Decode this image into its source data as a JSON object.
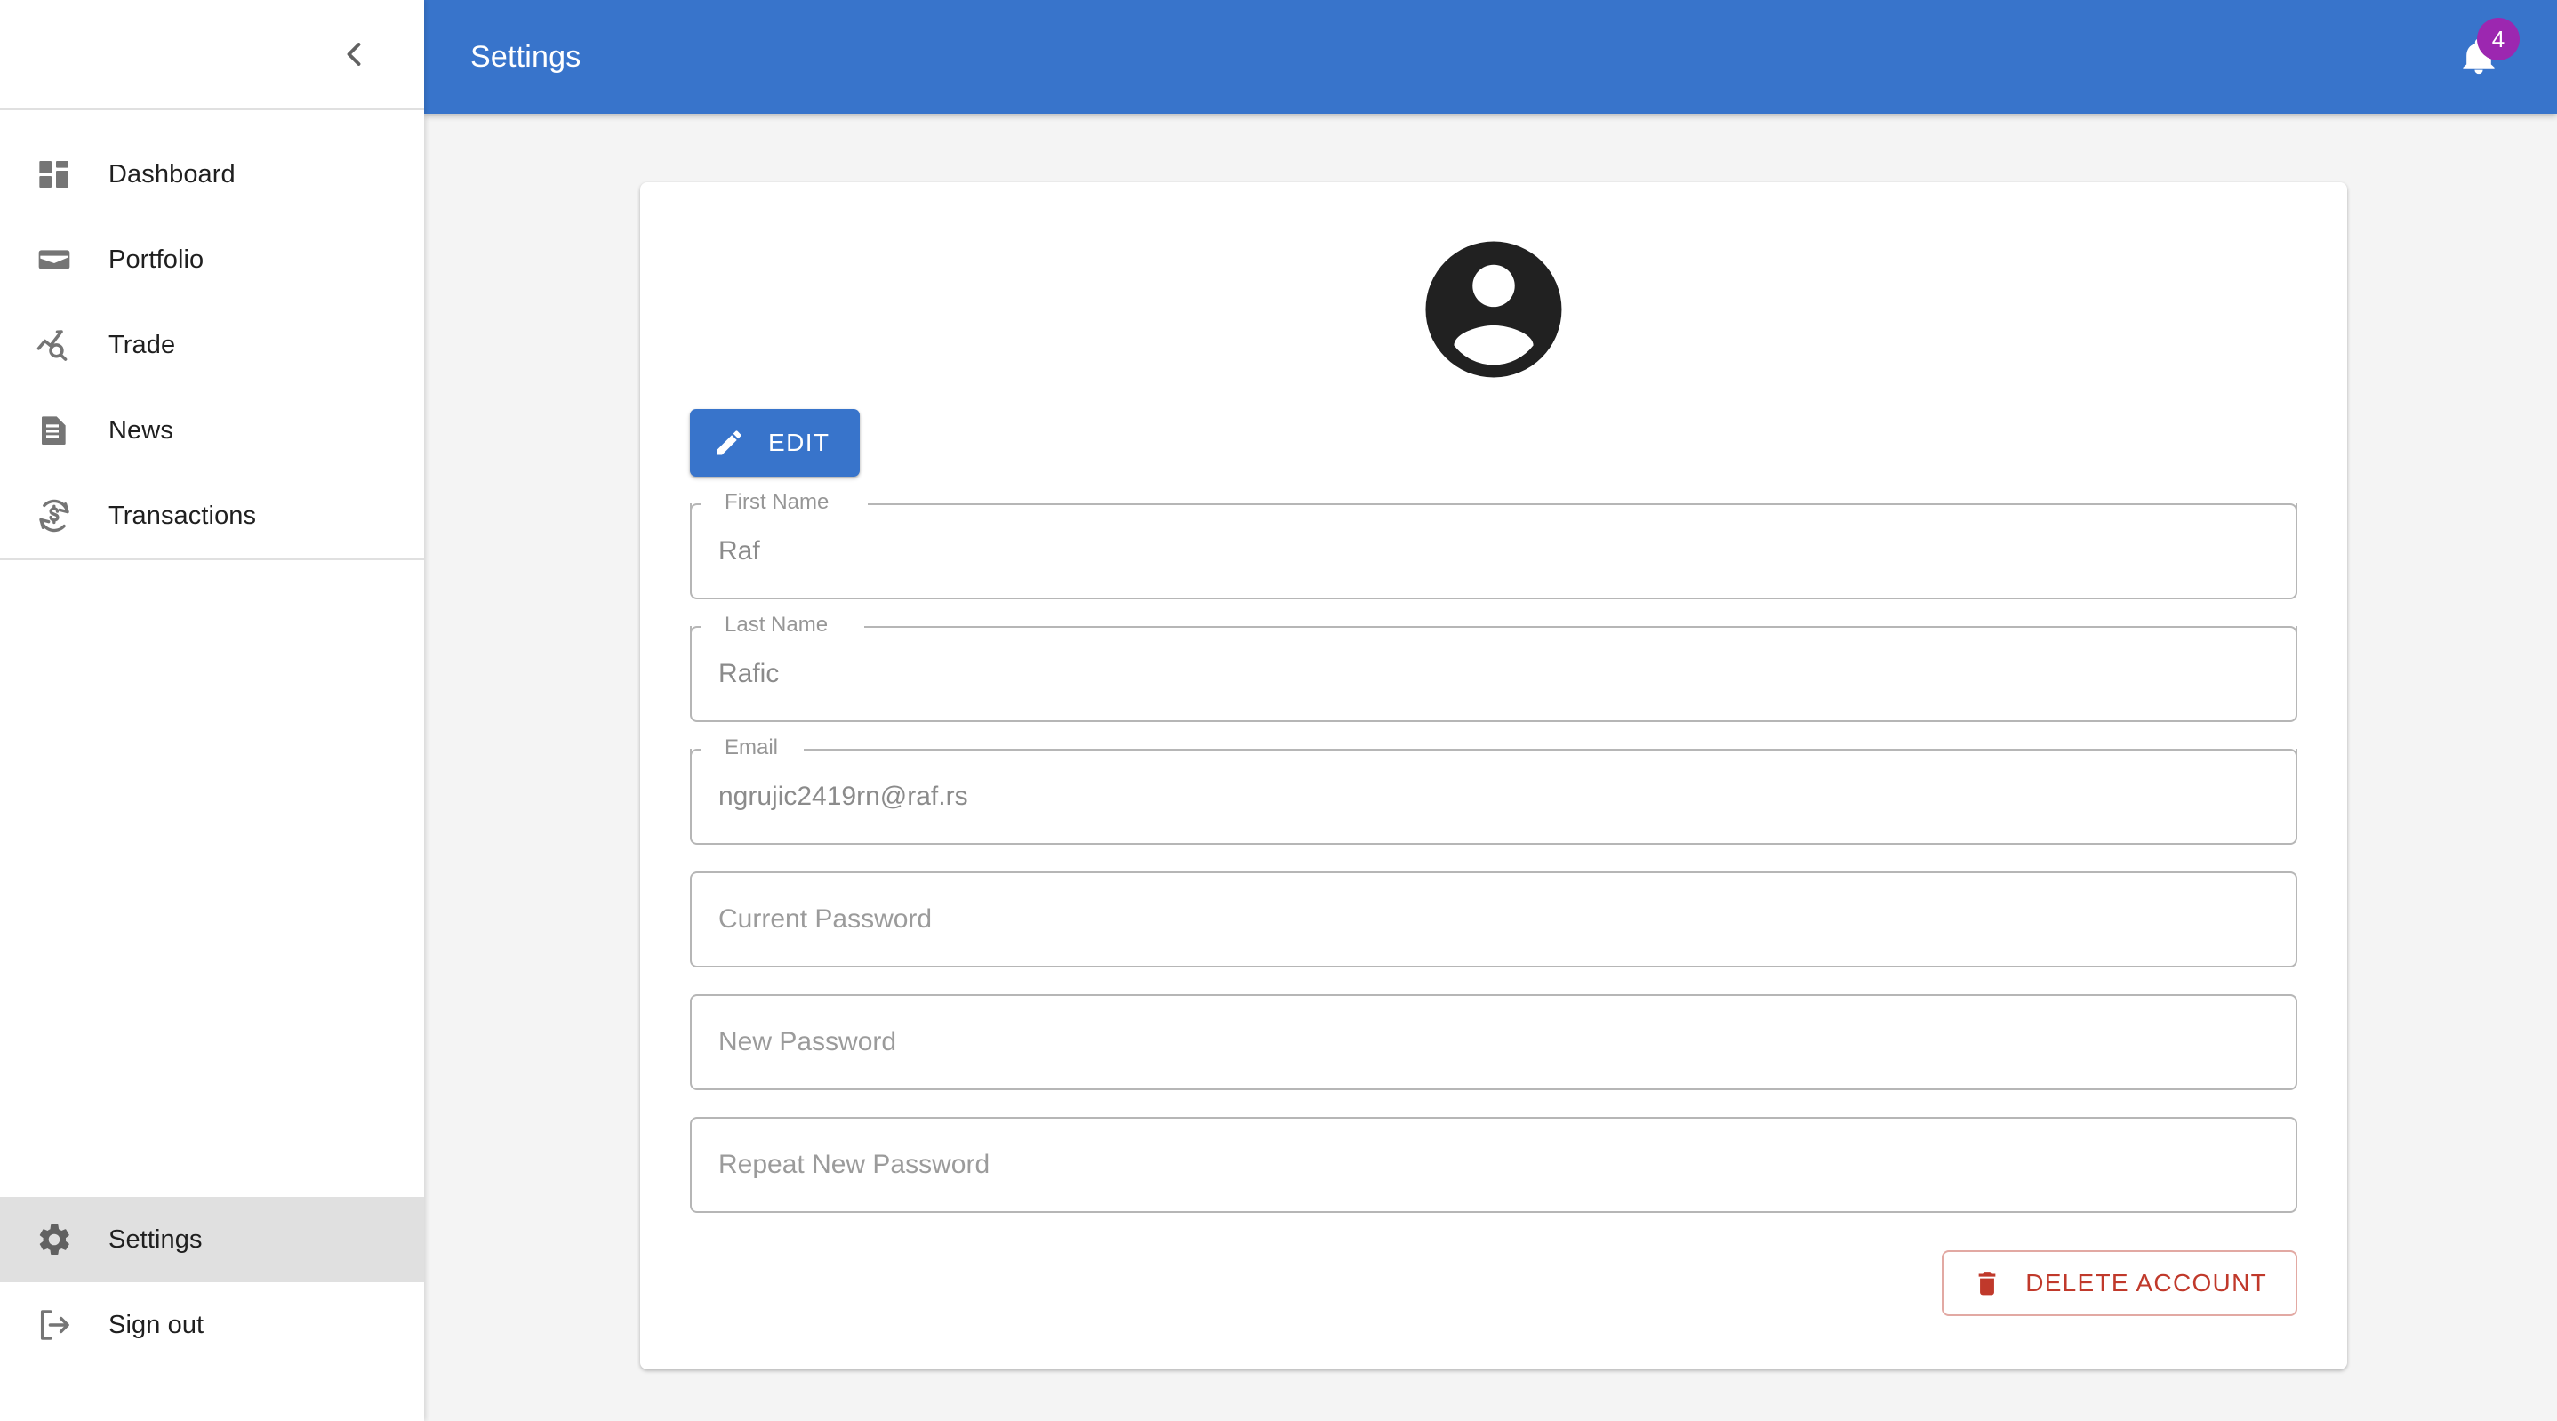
{
  "sidebar": {
    "collapse_icon": "chevron-left-icon",
    "primary_items": [
      {
        "id": "dashboard",
        "label": "Dashboard",
        "icon": "dashboard-icon",
        "active": false
      },
      {
        "id": "portfolio",
        "label": "Portfolio",
        "icon": "wallet-icon",
        "active": false
      },
      {
        "id": "trade",
        "label": "Trade",
        "icon": "trend-search-icon",
        "active": false
      },
      {
        "id": "news",
        "label": "News",
        "icon": "article-icon",
        "active": false
      },
      {
        "id": "transactions",
        "label": "Transactions",
        "icon": "currency-exchange-icon",
        "active": false
      }
    ],
    "bottom_items": [
      {
        "id": "settings",
        "label": "Settings",
        "icon": "gear-icon",
        "active": true
      },
      {
        "id": "signout",
        "label": "Sign out",
        "icon": "logout-icon",
        "active": false
      }
    ]
  },
  "topbar": {
    "title": "Settings",
    "background_color": "#3874cb",
    "notifications": {
      "icon": "bell-icon",
      "count": "4",
      "badge_color": "#9c27b0"
    }
  },
  "profile": {
    "avatar_icon": "account-circle-icon",
    "edit_button": {
      "label": "EDIT",
      "icon": "pencil-icon",
      "color": "#3874cb"
    },
    "fields": [
      {
        "id": "first-name",
        "label": "First Name",
        "value": "Raf",
        "placeholder": "",
        "type": "text",
        "notched": true
      },
      {
        "id": "last-name",
        "label": "Last Name",
        "value": "Rafic",
        "placeholder": "",
        "type": "text",
        "notched": true
      },
      {
        "id": "email",
        "label": "Email",
        "value": "ngrujic2419rn@raf.rs",
        "placeholder": "",
        "type": "text",
        "notched": true
      },
      {
        "id": "current-password",
        "label": "",
        "value": "",
        "placeholder": "Current Password",
        "type": "password",
        "notched": false
      },
      {
        "id": "new-password",
        "label": "",
        "value": "",
        "placeholder": "New Password",
        "type": "password",
        "notched": false
      },
      {
        "id": "repeat-password",
        "label": "",
        "value": "",
        "placeholder": "Repeat New Password",
        "type": "password",
        "notched": false
      }
    ],
    "delete_button": {
      "label": "DELETE ACCOUNT",
      "icon": "trash-icon",
      "color": "#c0392b"
    }
  }
}
